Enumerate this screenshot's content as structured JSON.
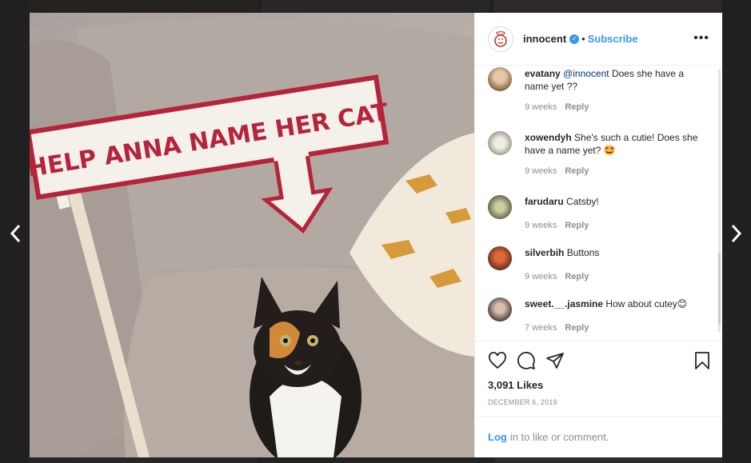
{
  "post": {
    "username": "innocent",
    "separator": "•",
    "subscribe_label": "Subscribe",
    "more_label": "•••",
    "likes": "3,091 Likes",
    "date": "DECEMBER 6, 2019",
    "login_link": "Log",
    "login_text": "in to like or comment."
  },
  "photo": {
    "sign_text": "HELP ANNA NAME HER CAT"
  },
  "comments": [
    {
      "user": "evatany",
      "mention": "@innocent",
      "text": " Does she have a name yet ??",
      "time": "9 weeks",
      "reply": "Reply"
    },
    {
      "user": "xowendyh",
      "mention": "",
      "text": " She's such a cutie! Does she have a name yet? 🤩",
      "time": "9 weeks",
      "reply": "Reply"
    },
    {
      "user": "farudaru",
      "mention": "",
      "text": " Catsby!",
      "time": "9 weeks",
      "reply": "Reply"
    },
    {
      "user": "silverbih",
      "mention": "",
      "text": " Buttons",
      "time": "9 weeks",
      "reply": "Reply"
    },
    {
      "user": "sweet.__.jasmine",
      "mention": "",
      "text": " How about cutey😊",
      "time": "7 weeks",
      "reply": "Reply"
    }
  ],
  "colors": {
    "accent": "#3897f0",
    "sign_red": "#b5243b"
  },
  "icons": [
    "chevron-left-icon",
    "chevron-right-icon",
    "verified-badge-icon",
    "heart-icon",
    "comment-icon",
    "share-icon",
    "bookmark-icon",
    "more-icon"
  ]
}
